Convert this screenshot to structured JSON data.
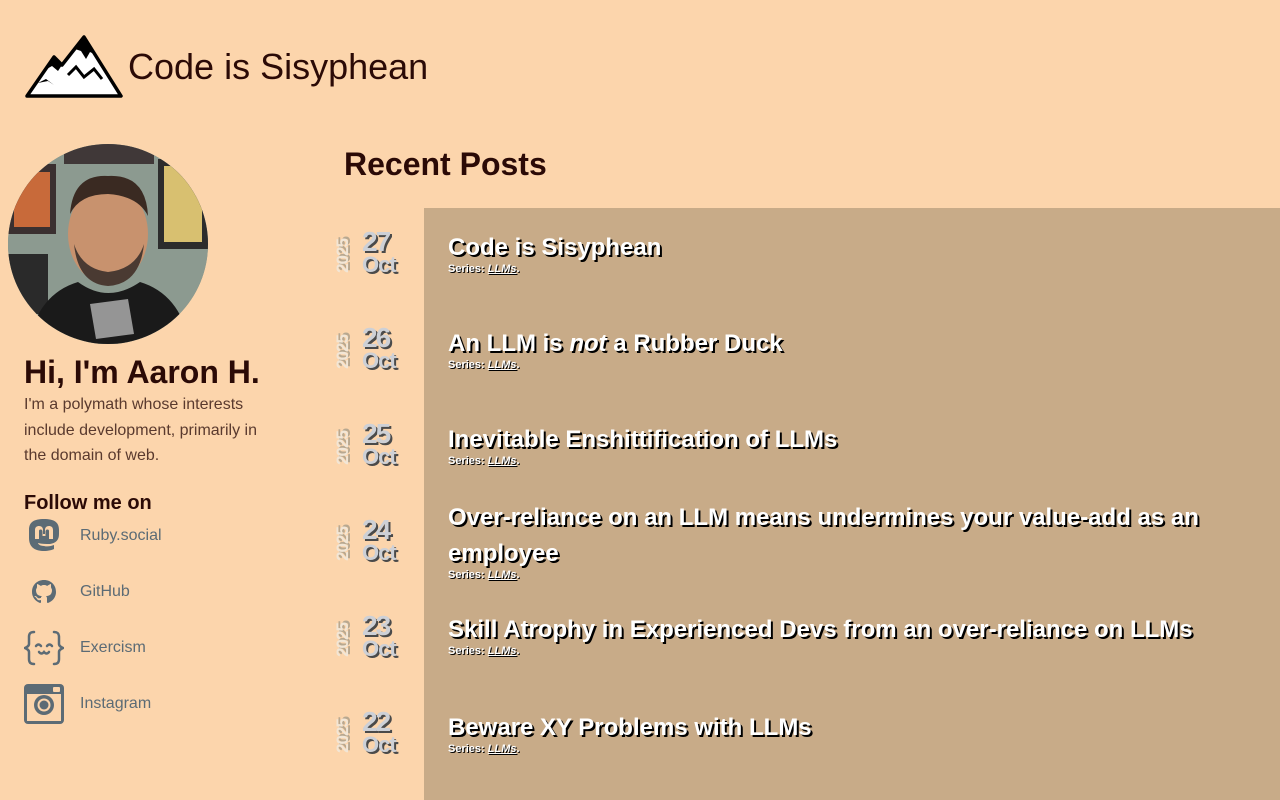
{
  "header": {
    "site_title": "Code is Sisyphean",
    "logo_icon": "mountain-logo-icon"
  },
  "sidebar": {
    "greeting": "Hi, I'm Aaron H.",
    "bio": "I'm a polymath whose interests include development, primarily in the domain of web.",
    "follow_heading": "Follow me on",
    "social": [
      {
        "label": "Ruby.social",
        "icon": "mastodon-icon"
      },
      {
        "label": "GitHub",
        "icon": "github-icon"
      },
      {
        "label": "Exercism",
        "icon": "exercism-icon"
      },
      {
        "label": "Instagram",
        "icon": "instagram-icon"
      }
    ]
  },
  "main": {
    "heading": "Recent Posts",
    "posts": [
      {
        "year": "2025",
        "day": "27",
        "month": "Oct",
        "title": "Code is Sisyphean",
        "series_prefix": "Series:",
        "series": "LLMs",
        "series_suffix": "."
      },
      {
        "year": "2025",
        "day": "26",
        "month": "Oct",
        "title_pre": "An LLM is ",
        "title_em": "not",
        "title_post": " a Rubber Duck",
        "series_prefix": "Series:",
        "series": "LLMs",
        "series_suffix": "."
      },
      {
        "year": "2025",
        "day": "25",
        "month": "Oct",
        "title": "Inevitable Enshittification of LLMs",
        "series_prefix": "Series:",
        "series": "LLMs",
        "series_suffix": "."
      },
      {
        "year": "2025",
        "day": "24",
        "month": "Oct",
        "title": "Over-reliance on an LLM means undermines your value-add as an employee",
        "series_prefix": "Series:",
        "series": "LLMs",
        "series_suffix": "."
      },
      {
        "year": "2025",
        "day": "23",
        "month": "Oct",
        "title": "Skill Atrophy in Experienced Devs from an over-reliance on LLMs",
        "series_prefix": "Series:",
        "series": "LLMs",
        "series_suffix": "."
      },
      {
        "year": "2025",
        "day": "22",
        "month": "Oct",
        "title": "Beware XY Problems with LLMs",
        "series_prefix": "Series:",
        "series": "LLMs",
        "series_suffix": "."
      }
    ]
  },
  "colors": {
    "background": "#fcd5ac",
    "posts_panel": "#c8ab88",
    "text": "#2b0a06",
    "link": "#5c6b75"
  }
}
